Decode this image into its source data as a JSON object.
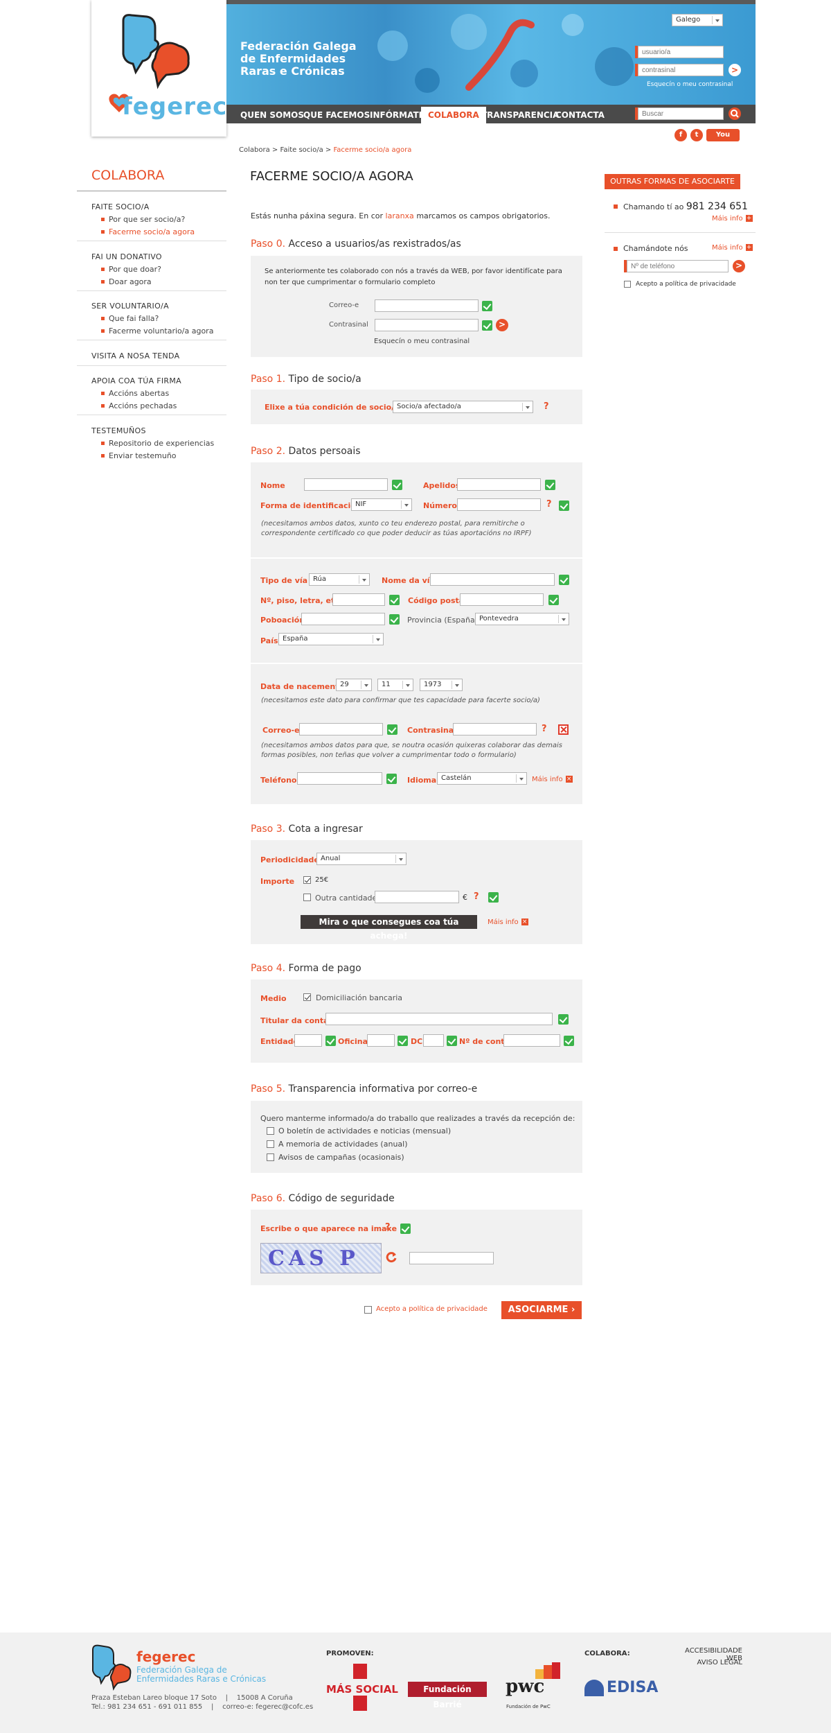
{
  "header": {
    "brand_lines": [
      "Federación Galega",
      "de Enfermidades",
      "Raras e Crónicas"
    ],
    "logo_word": "fegerec",
    "lang": "Galego",
    "login": {
      "user_placeholder": "usuario/a",
      "pass_placeholder": "contrasinal",
      "forgot": "Esquecín o meu contrasinal"
    },
    "search_placeholder": "Buscar",
    "nav": [
      "QUEN SOMOS",
      "QUE FACEMOS",
      "INFÓRMATE",
      "COLABORA",
      "TRANSPARENCIA",
      "CONTACTA"
    ],
    "social": {
      "facebook": "f",
      "twitter": "t",
      "youtube": "You Tube"
    }
  },
  "breadcrumb": {
    "a": "Colabora",
    "sep": ">",
    "b": "Faite socio/a",
    "c": "Facerme socio/a agora"
  },
  "sidebar": {
    "title": "COLABORA",
    "groups": [
      {
        "head": "FAITE SOCIO/A",
        "items": [
          "Por que ser socio/a?",
          "Facerme socio/a agora"
        ]
      },
      {
        "head": "FAI UN DONATIVO",
        "items": [
          "Por que doar?",
          "Doar agora"
        ]
      },
      {
        "head": "SER VOLUNTARIO/A",
        "items": [
          "Que fai falla?",
          "Facerme voluntario/a agora"
        ]
      },
      {
        "head": "VISITA A NOSA TENDA",
        "items": []
      },
      {
        "head": "APOIA COA TÚA FIRMA",
        "items": [
          "Accións abertas",
          "Accións pechadas"
        ]
      },
      {
        "head": "TESTEMUÑOS",
        "items": [
          "Repositorio de experiencias",
          "Enviar testemuño"
        ]
      }
    ]
  },
  "main": {
    "title": "FACERME SOCIO/A AGORA",
    "intro_a": "Estás nunha páxina segura. En cor",
    "intro_b": "laranxa",
    "intro_c": "marcamos os campos obrigatorios.",
    "step0": {
      "n": "Paso 0.",
      "t": "Acceso a usuarios/as rexistrados/as",
      "text1": "Se anteriormente tes colaborado con nós a través da WEB, por favor identifícate para",
      "text2": "non ter que cumprimentar o formulario completo",
      "email": "Correo-e",
      "pass": "Contrasinal",
      "forgot": "Esquecín o meu contrasinal"
    },
    "step1": {
      "n": "Paso 1.",
      "t": "Tipo de socio/a",
      "label": "Elixe a túa condición de socio/a",
      "value": "Socio/a afectado/a",
      "q": "?"
    },
    "step2": {
      "n": "Paso 2.",
      "t": "Datos persoais",
      "nome": "Nome",
      "apelidos": "Apelidos",
      "forma_id": "Forma de identificación",
      "forma_val": "NIF",
      "numero": "Número",
      "hint1a": "(necesitamos ambos datos, xunto co teu enderezo postal, para remitirche o",
      "hint1b": "correspondente certificado co que poder deducir as túas aportacións no IRPF)",
      "tipo_via": "Tipo de vía",
      "tipo_val": "Rúa",
      "nome_via": "Nome da vía",
      "piso": "Nº, piso, letra, etc.",
      "cp": "Código postal",
      "poboacion": "Poboación",
      "provincia": "Provincia (España)",
      "prov_val": "Pontevedra",
      "pais": "País",
      "pais_val": "España",
      "nac": "Data de nacemento",
      "d": "29",
      "m": "11",
      "y": "1973",
      "hint2": "(necesitamos este dato para confirmar que tes capacidade para facerte socio/a)",
      "email": "Correo-e",
      "pass": "Contrasinal",
      "hint3a": "(necesitamos ambos datos para que, se noutra ocasión quixeras colaborar das demais",
      "hint3b": "formas posibles, non teñas que volver a cumprimentar todo o formulario)",
      "tel": "Teléfono",
      "idioma": "Idioma",
      "idioma_val": "Castelán",
      "mais": "Máis info",
      "q": "?"
    },
    "step3": {
      "n": "Paso 3.",
      "t": "Cota a ingresar",
      "period": "Periodicidade",
      "period_val": "Anual",
      "importe": "Importe",
      "opt1": "25€",
      "opt2": "Outra cantidade",
      "euro": "€",
      "q": "?",
      "btn": "Mira o que consegues coa túa achega!",
      "mais": "Máis info"
    },
    "step4": {
      "n": "Paso 4.",
      "t": "Forma de pago",
      "medio": "Medio",
      "medio_val": "Domiciliación bancaria",
      "titular": "Titular da conta",
      "entidade": "Entidade",
      "oficina": "Oficina",
      "dc": "DC",
      "nconta": "Nº de conta"
    },
    "step5": {
      "n": "Paso 5.",
      "t": "Transparencia informativa por correo-e",
      "intro": "Quero manterme informado/a do traballo que realizades a través da recepción de:",
      "opts": [
        "O boletín de actividades e noticias (mensual)",
        "A memoria de actividades (anual)",
        "Avisos de campañas (ocasionais)"
      ]
    },
    "step6": {
      "n": "Paso 6.",
      "t": "Código de seguridade",
      "label": "Escribe o que aparece na imaxe",
      "q": "?",
      "captcha": "CAS P"
    },
    "privacy": "Acepto a política de privacidade",
    "submit": "ASOCIARME"
  },
  "right": {
    "title": "OUTRAS FORMAS DE ASOCIARTE",
    "call": "Chamando tí ao",
    "phone": "981 234 651",
    "mais": "Máis info",
    "callme": "Chamándote nós",
    "tel_placeholder": "Nº de teléfono",
    "privacy": "Acepto a política de privacidade"
  },
  "footer": {
    "logo": "fegerec",
    "name1": "Federación Galega de",
    "name2": "Enfermidades Raras e Crónicas",
    "addr": "Praza Esteban Lareo bloque 17 Soto    |    15008 A Coruña",
    "contact": "Tel.: 981 234 651 - 691 011 855    |    correo-e: fegerec@cofc.es",
    "promoven": "PROMOVEN:",
    "mas_social": "MÁS SOCIAL",
    "barrie": "Fundación Barrié",
    "pwc": "pwc",
    "pwc_sub": "Fundación de PwC",
    "colabora": "COLABORA:",
    "edisa": "EDISA",
    "acc": "ACCESIBILIDADE WEB",
    "legal": "AVISO LEGAL"
  },
  "colors": {
    "accent": "#e8502a",
    "header_blue": "#3d9fd3",
    "nav_bg": "#4a4a4a",
    "panel": "#f1f1f1"
  }
}
